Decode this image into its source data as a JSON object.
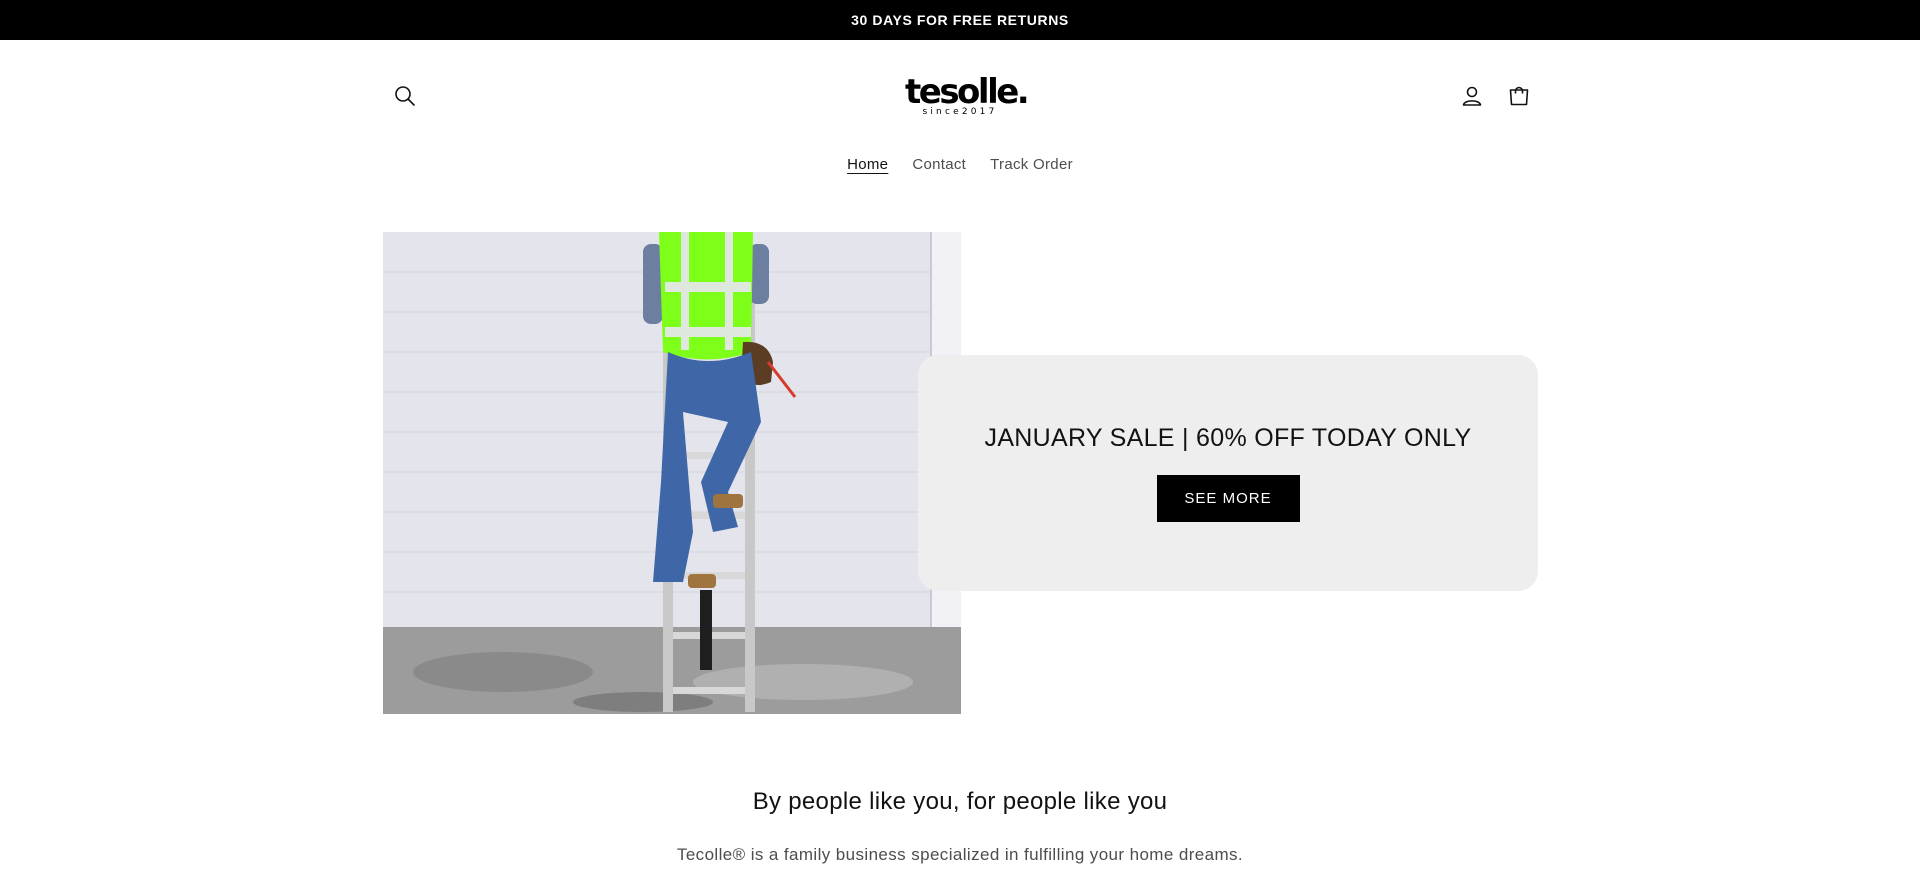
{
  "announcement": {
    "text": "30 DAYS FOR FREE RETURNS"
  },
  "header": {
    "logo": {
      "wordmark": "tesolle.",
      "tagline": "since2017"
    },
    "icons": [
      "search-icon",
      "account-icon",
      "cart-icon"
    ]
  },
  "nav": {
    "items": [
      {
        "label": "Home",
        "active": true
      },
      {
        "label": "Contact",
        "active": false
      },
      {
        "label": "Track Order",
        "active": false
      }
    ]
  },
  "hero": {
    "promo_heading": "JANUARY SALE | 60% OFF TODAY ONLY",
    "button_label": "SEE MORE"
  },
  "about": {
    "title": "By people like you, for people like you",
    "text": "Tecolle® is a family business specialized in fulfilling your home dreams."
  },
  "colors": {
    "announcement_bg": "#000000",
    "card_bg": "#eeeeee",
    "button_bg": "#000000",
    "vest": "#7dff1a",
    "jeans": "#3f67a8"
  }
}
